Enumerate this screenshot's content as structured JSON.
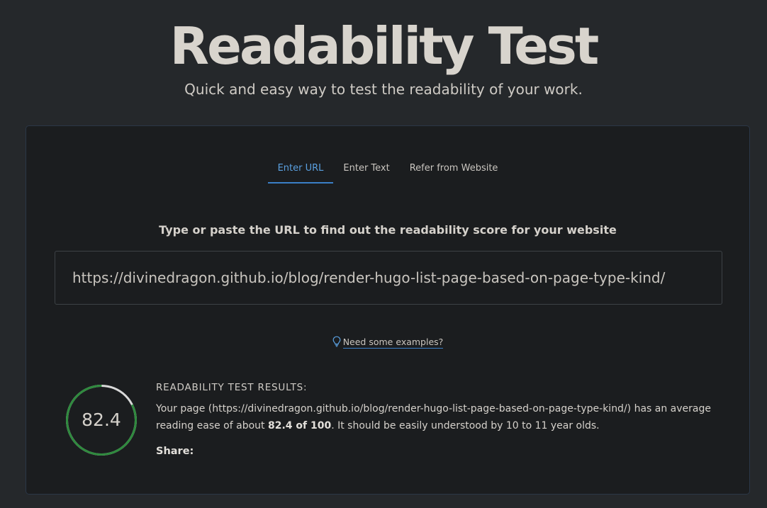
{
  "header": {
    "title": "Readability Test",
    "subtitle": "Quick and easy way to test the readability of your work."
  },
  "tabs": [
    {
      "label": "Enter URL",
      "active": true
    },
    {
      "label": "Enter Text",
      "active": false
    },
    {
      "label": "Refer from Website",
      "active": false
    }
  ],
  "url_form": {
    "prompt": "Type or paste the URL to find out the readability score for your website",
    "input_value": "https://divinedragon.github.io/blog/render-hugo-list-page-based-on-page-type-kind/",
    "examples_link": "Need some examples?"
  },
  "results": {
    "score": "82.4",
    "score_fraction": 0.824,
    "heading": "READABILITY TEST RESULTS:",
    "text_prefix": "Your page (https://divinedragon.github.io/blog/render-hugo-list-page-based-on-page-type-kind/) has an average reading ease of about ",
    "text_score": "82.4 of 100",
    "text_suffix": ". It should be easily understood by 10 to 11 year olds.",
    "share_label": "Share:"
  },
  "colors": {
    "background": "#25282b",
    "card": "#1b1d1f",
    "accent": "#5aa0e0",
    "ring_fill": "#2f8a3e",
    "ring_track": "#d9d9d9"
  },
  "icons": {
    "examples_icon": "lightbulb-icon"
  }
}
